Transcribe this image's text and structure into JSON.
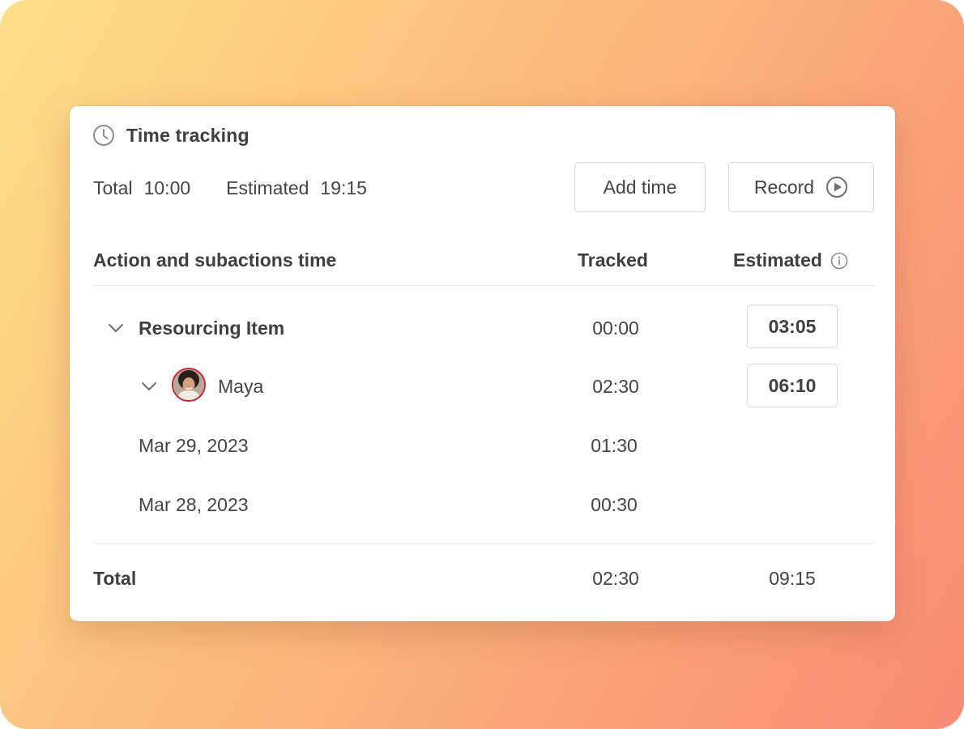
{
  "header": {
    "title": "Time tracking",
    "total_label": "Total",
    "total_value": "10:00",
    "estimated_label": "Estimated",
    "estimated_value": "19:15"
  },
  "buttons": {
    "add_time": "Add time",
    "record": "Record"
  },
  "columns": {
    "action": "Action and subactions time",
    "tracked": "Tracked",
    "estimated": "Estimated"
  },
  "rows": [
    {
      "label": "Resourcing Item",
      "tracked": "00:00",
      "estimated": "03:05"
    },
    {
      "label": "Maya",
      "tracked": "02:30",
      "estimated": "06:10"
    },
    {
      "label": "Mar 29, 2023",
      "tracked": "01:30"
    },
    {
      "label": "Mar 28, 2023",
      "tracked": "00:30"
    }
  ],
  "footer": {
    "label": "Total",
    "tracked": "02:30",
    "estimated": "09:15"
  },
  "icons": {
    "clock": "clock-icon",
    "play": "play-circle-icon",
    "info": "info-icon",
    "chevron": "chevron-down-icon"
  }
}
